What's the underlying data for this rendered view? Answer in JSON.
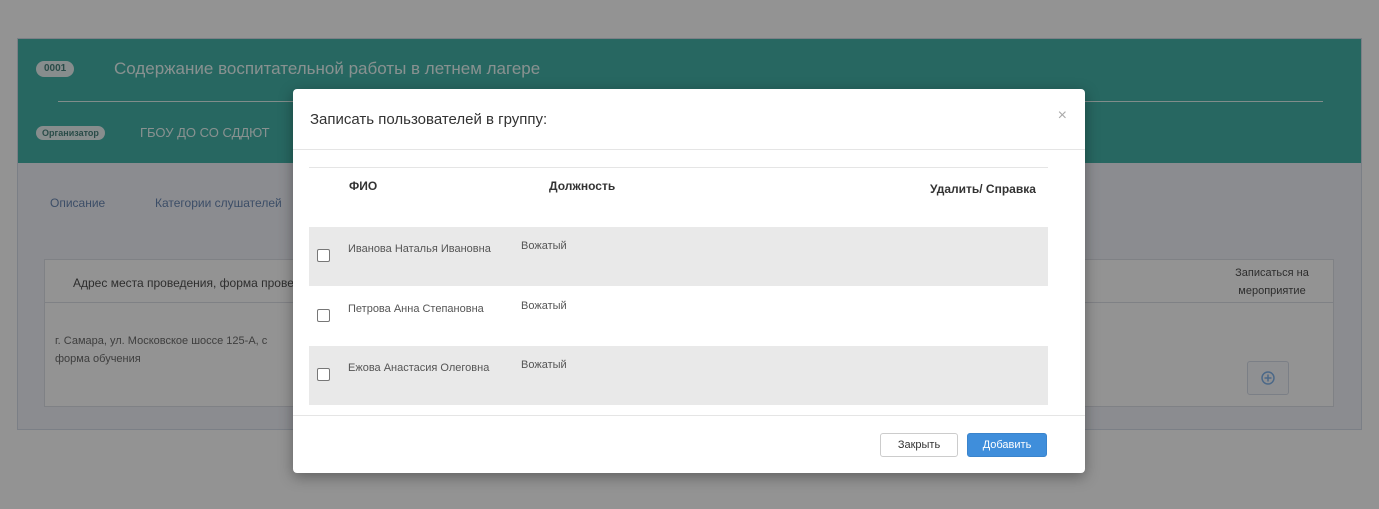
{
  "event": {
    "code": "0001",
    "title": "Содержание воспитательной работы в летнем лагере",
    "organizer_badge": "Организатор",
    "organizer_name": "ГБОУ ДО СО СДДЮТ"
  },
  "tabs": [
    "Описание",
    "Категории слушателей"
  ],
  "info_table": {
    "col_address": "Адрес места проведения, форма прове",
    "col_join": "Записаться на мероприятие",
    "address_value": "г. Самара, ул. Московское шоссе 125-А, с форма обучения"
  },
  "modal": {
    "title": "Записать пользователей в группу:",
    "close_glyph": "×",
    "columns": {
      "fio": "ФИО",
      "position": "Должность",
      "delete": "Удалить/ Справка"
    },
    "rows": [
      {
        "fio": "Иванова Наталья Ивановна",
        "position": "Вожатый"
      },
      {
        "fio": "Петрова Анна Степановна",
        "position": "Вожатый"
      },
      {
        "fio": "Ежова Анастасия Олеговна",
        "position": "Вожатый"
      }
    ],
    "buttons": {
      "close": "Закрыть",
      "add": "Добавить"
    }
  },
  "colors": {
    "header_teal": "#26a69a",
    "primary_button": "#3f8edb",
    "row_stripe": "#e9e9e9"
  },
  "icons": {
    "join": "plus-circle-icon",
    "close": "close-icon"
  }
}
